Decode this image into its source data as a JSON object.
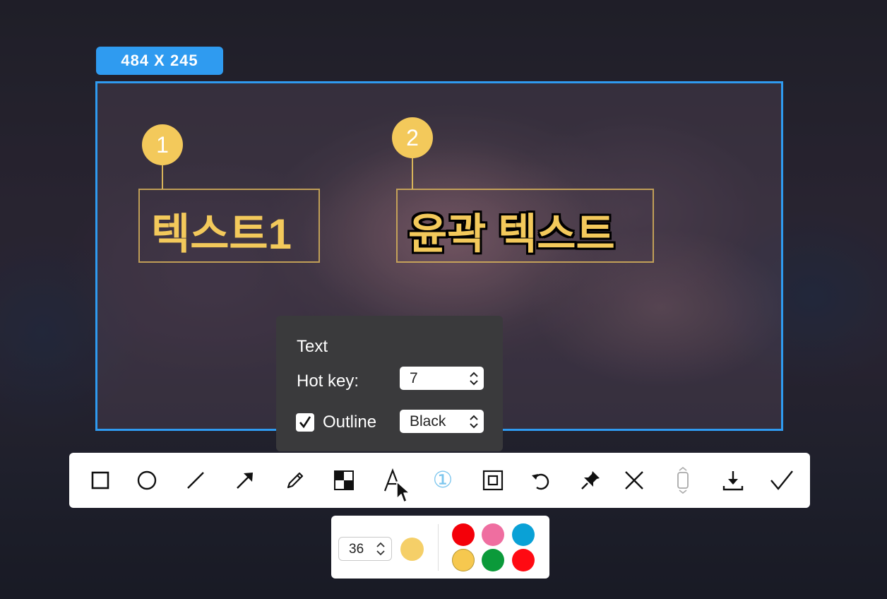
{
  "selection": {
    "size_label": "484  X  245"
  },
  "markers": [
    {
      "number": "1",
      "text": "텍스트1"
    },
    {
      "number": "2",
      "text": "윤곽 텍스트"
    }
  ],
  "popup": {
    "title": "Text",
    "hotkey_label": "Hot key:",
    "hotkey_value": "7",
    "outline_checked": true,
    "outline_label": "Outline",
    "outline_color": "Black"
  },
  "toolbar": {
    "tools": [
      {
        "name": "rectangle-icon"
      },
      {
        "name": "ellipse-icon"
      },
      {
        "name": "line-icon"
      },
      {
        "name": "arrow-icon"
      },
      {
        "name": "pencil-icon"
      },
      {
        "name": "mosaic-icon"
      },
      {
        "name": "text-tool-icon",
        "active": true
      },
      {
        "name": "number-marker-icon"
      },
      {
        "name": "highlight-rect-icon"
      },
      {
        "name": "undo-icon"
      },
      {
        "name": "pin-icon"
      },
      {
        "name": "close-icon"
      },
      {
        "name": "scroll-capture-icon",
        "disabled": true
      },
      {
        "name": "download-icon"
      },
      {
        "name": "confirm-icon"
      }
    ],
    "marker_tool_glyph": "①"
  },
  "style_bar": {
    "font_size": "36",
    "current_color": "#f5cf68",
    "palette": [
      "#f40009",
      "#ef6ea0",
      "#0aa1d6",
      "#f6c84f",
      "#0b9a3a",
      "#ff0a12"
    ]
  },
  "colors": {
    "accent": "#2f9bf0",
    "marker": "#f3c95b"
  }
}
